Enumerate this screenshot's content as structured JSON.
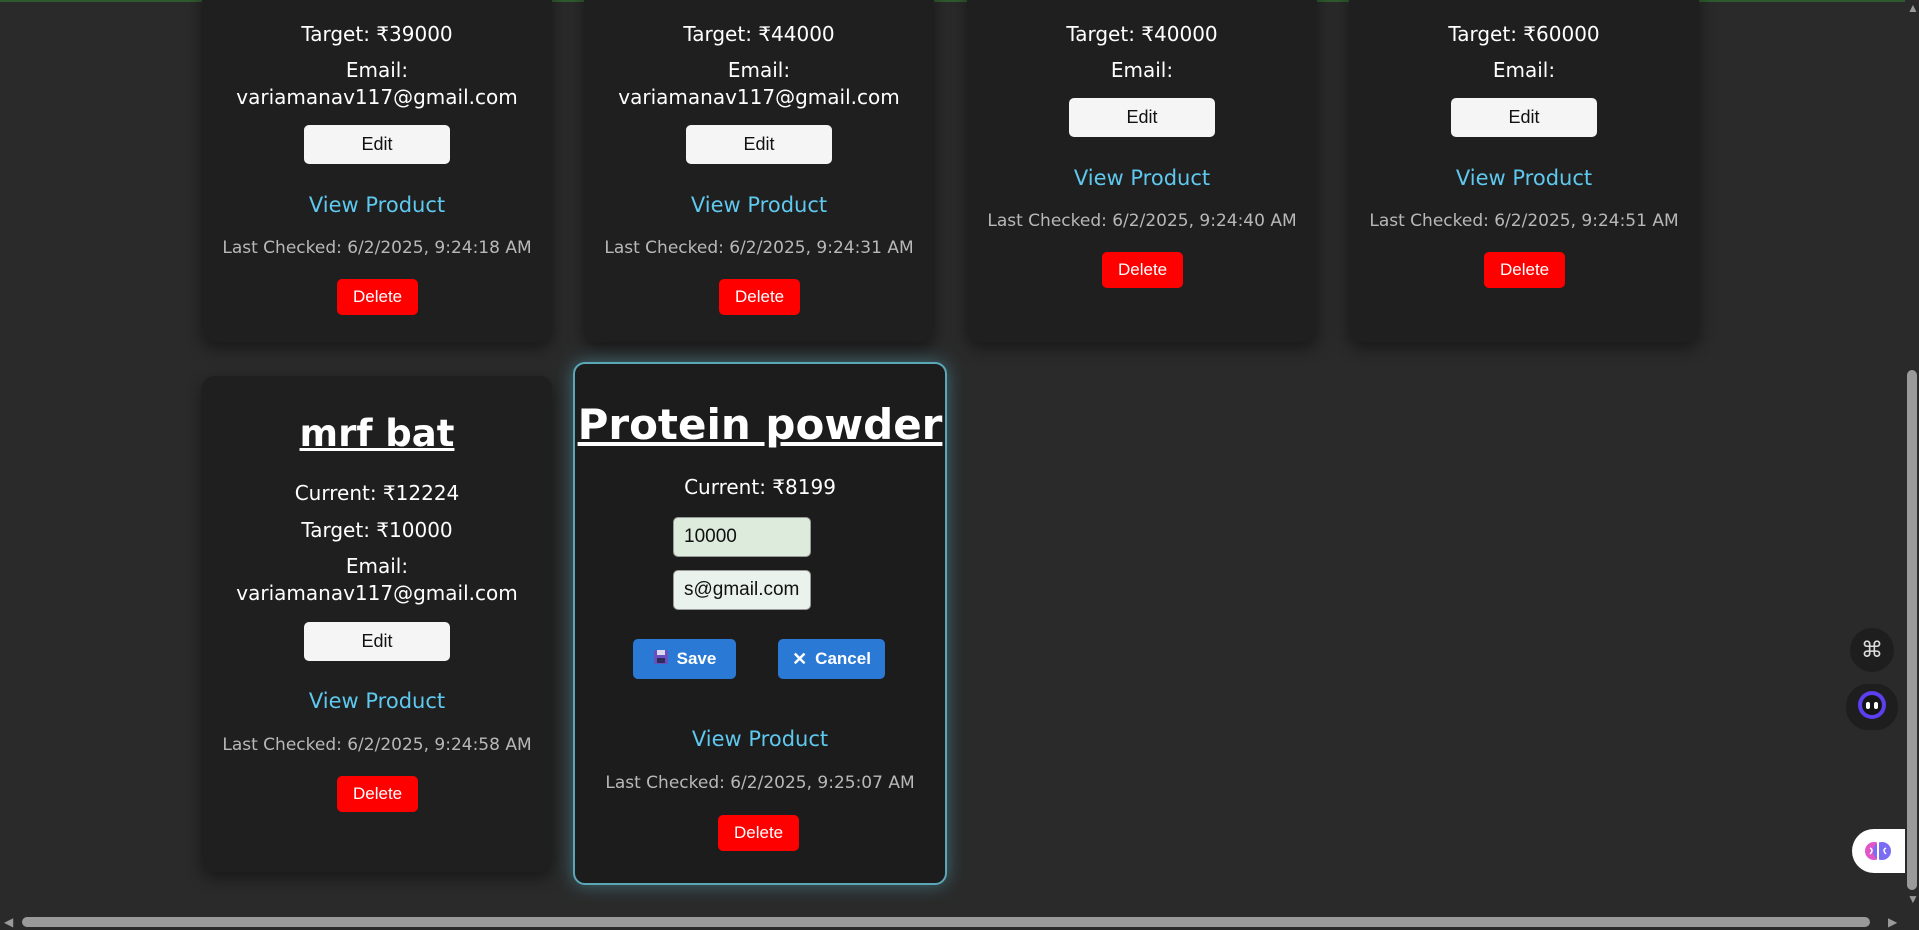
{
  "cards_top": [
    {
      "target": "Target: ₹39000",
      "email_label": "Email:",
      "email": "variamanav117@gmail.com",
      "edit": "Edit",
      "view": "View Product",
      "checked": "Last Checked: 6/2/2025, 9:24:18 AM",
      "delete": "Delete"
    },
    {
      "target": "Target: ₹44000",
      "email_label": "Email:",
      "email": "variamanav117@gmail.com",
      "edit": "Edit",
      "view": "View Product",
      "checked": "Last Checked: 6/2/2025, 9:24:31 AM",
      "delete": "Delete"
    },
    {
      "target": "Target: ₹40000",
      "email_label": "Email:",
      "edit": "Edit",
      "view": "View Product",
      "checked": "Last Checked: 6/2/2025, 9:24:40 AM",
      "delete": "Delete"
    },
    {
      "target": "Target: ₹60000",
      "email_label": "Email:",
      "edit": "Edit",
      "view": "View Product",
      "checked": "Last Checked: 6/2/2025, 9:24:51 AM",
      "delete": "Delete"
    }
  ],
  "card_mrf": {
    "title": "mrf bat",
    "current": "Current: ₹12224",
    "target": "Target: ₹10000",
    "email_label": "Email:",
    "email": "variamanav117@gmail.com",
    "edit": "Edit",
    "view": "View Product",
    "checked": "Last Checked: 6/2/2025, 9:24:58 AM",
    "delete": "Delete"
  },
  "card_protein": {
    "title": "Protein powder",
    "current": "Current: ₹8199",
    "target_value": "10000",
    "email_value": "s@gmail.com",
    "save": "Save",
    "cancel": "Cancel",
    "view": "View Product",
    "checked": "Last Checked: 6/2/2025, 9:25:07 AM",
    "delete": "Delete"
  },
  "icons": {
    "save": "floppy-disk-icon",
    "cancel": "x-icon",
    "command": "command-icon",
    "assistant": "assistant-face-icon",
    "brain": "brain-icon"
  },
  "colors": {
    "background": "#2a2a2a",
    "card": "#1f1f1f",
    "link": "#5fc8ee",
    "delete": "#ff0000",
    "primary": "#2a7ad5"
  }
}
